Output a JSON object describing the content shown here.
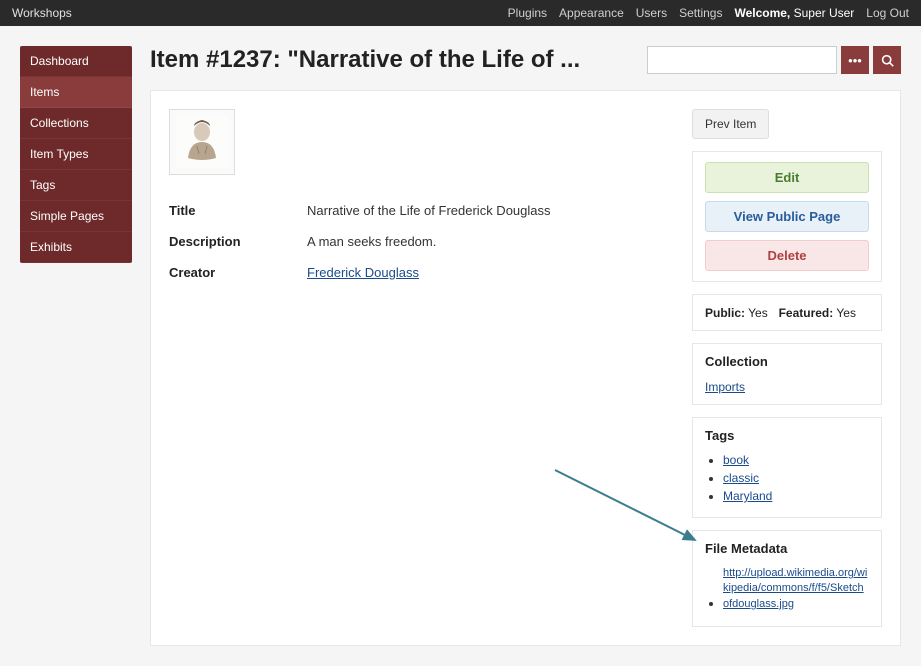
{
  "topbar": {
    "brand": "Workshops",
    "links": {
      "plugins": "Plugins",
      "appearance": "Appearance",
      "users": "Users",
      "settings": "Settings",
      "welcome_prefix": "Welcome,",
      "welcome_user": " Super User",
      "logout": "Log Out"
    }
  },
  "sidenav": {
    "items": [
      {
        "label": "Dashboard"
      },
      {
        "label": "Items"
      },
      {
        "label": "Collections"
      },
      {
        "label": "Item Types"
      },
      {
        "label": "Tags"
      },
      {
        "label": "Simple Pages"
      },
      {
        "label": "Exhibits"
      }
    ]
  },
  "header": {
    "title": "Item #1237: \"Narrative of the Life of ..."
  },
  "search": {
    "placeholder": ""
  },
  "item": {
    "fields": {
      "title_label": "Title",
      "title_value": "Narrative of the Life of Frederick Douglass",
      "desc_label": "Description",
      "desc_value": "A man seeks freedom.",
      "creator_label": "Creator",
      "creator_value": "Frederick Douglass"
    }
  },
  "rail": {
    "prev": "Prev Item",
    "actions": {
      "edit": "Edit",
      "view": "View Public Page",
      "delete": "Delete"
    },
    "status": {
      "public_label": "Public:",
      "public_value": " Yes",
      "featured_label": "Featured:",
      "featured_value": " Yes"
    },
    "collection": {
      "heading": "Collection",
      "link": "Imports"
    },
    "tags": {
      "heading": "Tags",
      "items": [
        "book",
        "classic",
        "Maryland"
      ]
    },
    "filemeta": {
      "heading": "File Metadata",
      "url": "http://upload.wikimedia.org/wikipedia/commons/f/f5/Sketchofdouglass.jpg"
    }
  }
}
